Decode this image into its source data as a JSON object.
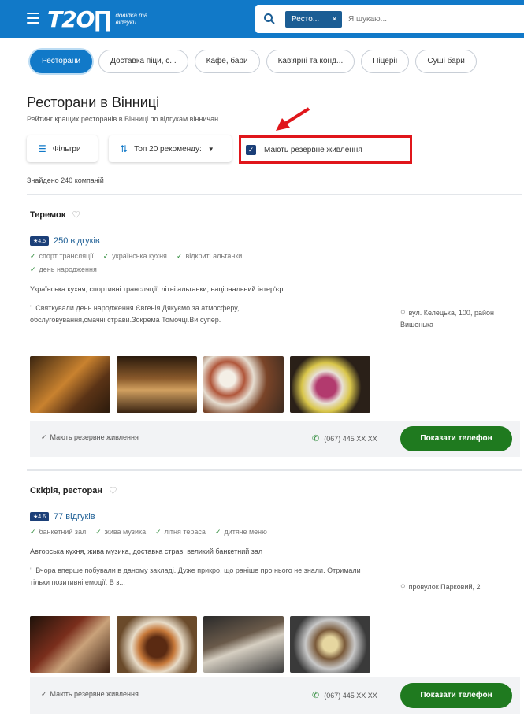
{
  "header": {
    "logo": "T2O∏",
    "logo_tagline": "довідка та відгуки",
    "search_chip": "Ресто...",
    "search_chip_close": "×",
    "search_placeholder": "Я шукаю..."
  },
  "categories": [
    {
      "label": "Ресторани",
      "active": true
    },
    {
      "label": "Доставка піци, с...",
      "active": false
    },
    {
      "label": "Кафе, бари",
      "active": false
    },
    {
      "label": "Кав'ярні та конд...",
      "active": false
    },
    {
      "label": "Піцерії",
      "active": false
    },
    {
      "label": "Суші бари",
      "active": false
    }
  ],
  "page": {
    "title": "Ресторани в Вінниці",
    "subtitle": "Рейтинг кращих ресторанів в Вінниці по відгукам вінничан",
    "filters_label": "Фільтри",
    "sort_label": "Топ 20 рекоменду:",
    "sort_chevron": "▼",
    "checkbox_label": "Мають резервне живлення",
    "found_text": "Знайдено 240 компаній"
  },
  "listings": [
    {
      "name": "Теремок",
      "rating": "4.5",
      "reviews": "250 відгуків",
      "tags": [
        "спорт трансляції",
        "українська кухня",
        "відкриті альтанки",
        "день народження"
      ],
      "description": "Українська кухня, спортивні трансляції, літні альтанки, національний інтер'єр",
      "review": "Святкували день народження Євгенія.Дякуємо за атмосферу, обслуговування,смачні страви.Зокрема Томочці.Ви супер.",
      "address": "вул. Келецька, 100, район Вишенька",
      "feature": "Мають резервне живлення",
      "phone": "(067) 445 XX XX",
      "button": "Показати телефон"
    },
    {
      "name": "Скіфія, ресторан",
      "rating": "4.6",
      "reviews": "77 відгуків",
      "tags": [
        "банкетний зал",
        "жива музика",
        "літня тераса",
        "дитяче меню"
      ],
      "description": "Авторська кухня, жива музика, доставка страв, великий банкетний зал",
      "review": "Вчора вперше побували в даному закладі. Дуже прикро, що раніше про нього не знали. Отримали тільки позитивні емоції. В з...",
      "address": "провулок Парковий, 2",
      "feature": "Мають резервне живлення",
      "phone": "(067) 445 XX XX",
      "button": "Показати телефон"
    }
  ],
  "colors": {
    "brand": "#1179c8",
    "highlight_border": "#e0161b",
    "button_green": "#1f7a1f"
  }
}
